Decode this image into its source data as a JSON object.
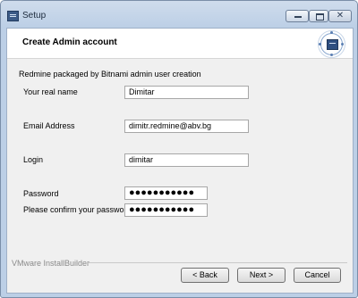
{
  "window": {
    "title": "Setup"
  },
  "header": {
    "title": "Create Admin account"
  },
  "form": {
    "section_title": "Redmine packaged by Bitnami admin user creation",
    "real_name": {
      "label": "Your real name",
      "value": "Dimitar"
    },
    "email": {
      "label": "Email Address",
      "value": "dimitr.redmine@abv.bg"
    },
    "login": {
      "label": "Login",
      "value": "dimitar"
    },
    "password": {
      "label": "Password",
      "value": "●●●●●●●●●●●"
    },
    "confirm_password": {
      "label": "Please confirm your password",
      "value": "●●●●●●●●●●●"
    }
  },
  "footer": {
    "brand": "VMware InstallBuilder",
    "back_label": "< Back",
    "next_label": "Next >",
    "cancel_label": "Cancel"
  },
  "icons": {
    "app": "window-app-icon",
    "minimize": "minimize-icon",
    "maximize": "maximize-icon",
    "close": "close-icon",
    "logo": "installer-logo-icon"
  }
}
